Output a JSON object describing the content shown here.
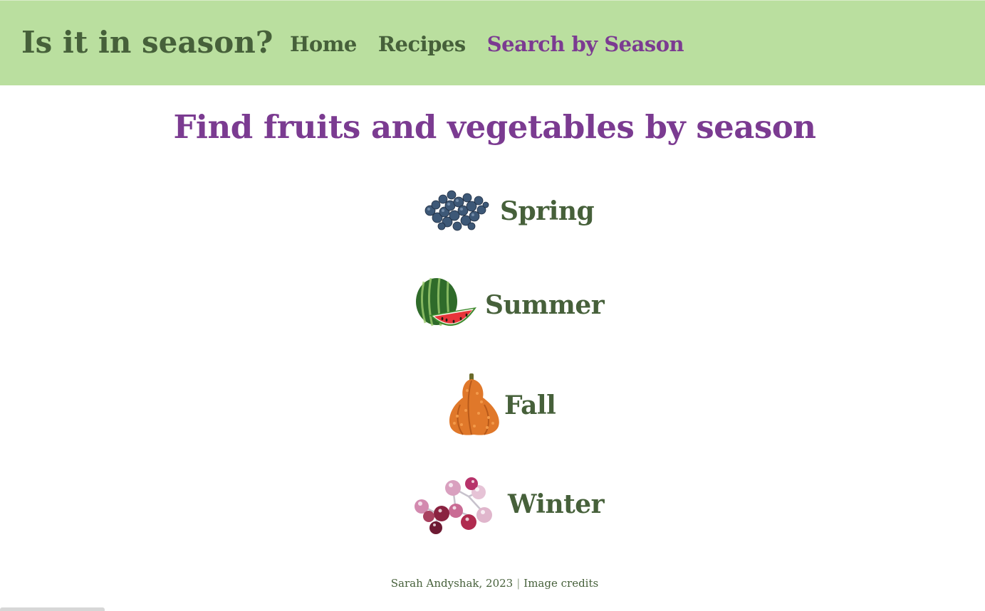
{
  "header": {
    "brand": "Is it in season?",
    "nav": [
      {
        "label": "Home"
      },
      {
        "label": "Recipes"
      },
      {
        "label": "Search by Season",
        "active": true
      }
    ]
  },
  "main": {
    "title": "Find fruits and vegetables by season",
    "seasons": [
      {
        "label": "Spring",
        "image": "blueberries"
      },
      {
        "label": "Summer",
        "image": "watermelon"
      },
      {
        "label": "Fall",
        "image": "orange-gourd"
      },
      {
        "label": "Winter",
        "image": "frosted-berries"
      }
    ]
  },
  "footer": {
    "author": "Sarah Andyshak, 2023",
    "separator": "|",
    "credits_link": "Image credits"
  },
  "colors": {
    "header_bg": "#badf9f",
    "text_green": "#46603a",
    "accent_purple": "#7b3b91"
  }
}
